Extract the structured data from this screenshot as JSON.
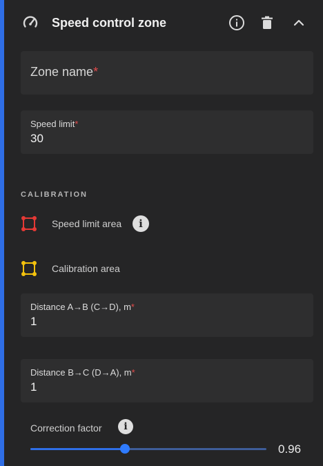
{
  "header": {
    "title": "Speed control zone",
    "icons": [
      "speedometer-icon",
      "info-icon",
      "trash-icon",
      "chevron-up-icon"
    ]
  },
  "zone_name": {
    "label": "Zone name",
    "required_mark": "*",
    "value": ""
  },
  "speed_limit": {
    "label": "Speed limit",
    "required_mark": "*",
    "value": "30"
  },
  "calibration": {
    "heading": "CALIBRATION",
    "speed_limit_area": {
      "label": "Speed limit area",
      "color": "#e53935",
      "info_glyph": "i"
    },
    "calibration_area": {
      "label": "Calibration area",
      "color": "#f4c20d"
    },
    "distance_ab": {
      "label": "Distance A→B (C→D), m",
      "required_mark": "*",
      "value": "1"
    },
    "distance_bc": {
      "label": "Distance B→C (D→A), m",
      "required_mark": "*",
      "value": "1"
    },
    "correction_factor": {
      "label": "Correction factor",
      "info_glyph": "i",
      "value": "0.96",
      "min": 0,
      "max": 2,
      "position_fraction": 0.4
    }
  },
  "colors": {
    "accent": "#2f6ee6",
    "required": "#e24b4b",
    "background": "#252526",
    "field_background": "#2e2e2f"
  }
}
